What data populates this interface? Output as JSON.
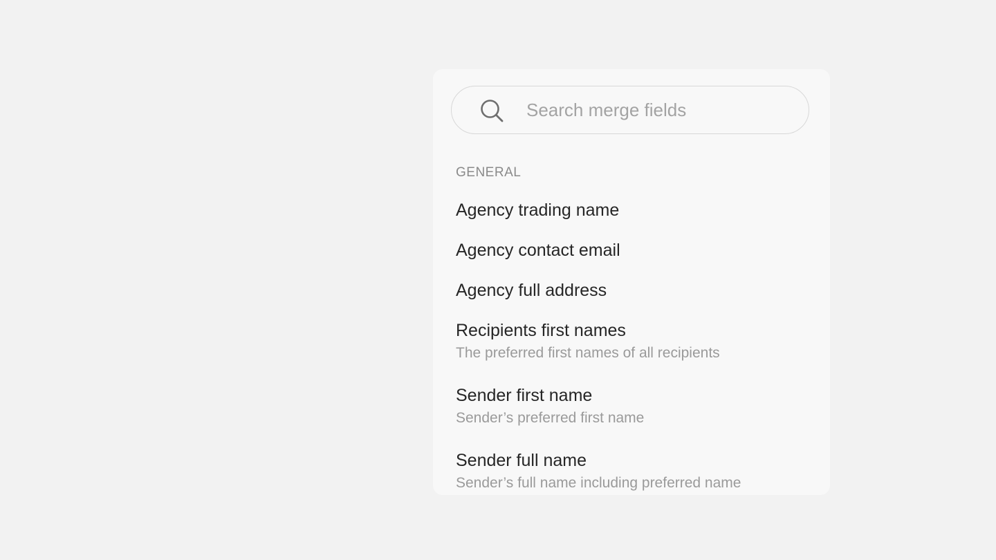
{
  "search": {
    "placeholder": "Search merge fields",
    "value": ""
  },
  "sections": [
    {
      "heading": "GENERAL",
      "items": [
        {
          "title": "Agency trading name",
          "description": ""
        },
        {
          "title": "Agency contact email",
          "description": ""
        },
        {
          "title": "Agency full address",
          "description": ""
        },
        {
          "title": "Recipients first names",
          "description": "The preferred first names of all recipients"
        },
        {
          "title": "Sender first name",
          "description": "Sender’s preferred first name"
        },
        {
          "title": "Sender full name",
          "description": "Sender’s full name including preferred name"
        }
      ]
    }
  ],
  "icons": {
    "search": "search-icon"
  },
  "colors": {
    "background": "#f2f2f2",
    "panel": "#f8f8f8",
    "text_primary": "#262626",
    "text_secondary": "#9a9a9a",
    "heading": "#8a8a8a"
  }
}
